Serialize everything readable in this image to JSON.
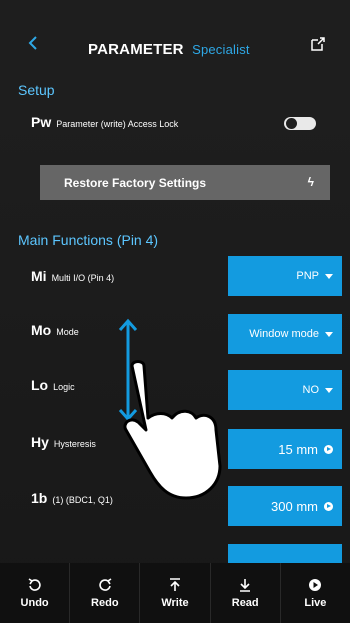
{
  "header": {
    "title": "PARAMETER",
    "subtitle": "Specialist"
  },
  "setup": {
    "section_label": "Setup",
    "lock": {
      "code": "Pw",
      "label": "Parameter (write) Access Lock",
      "enabled": false
    },
    "restore_label": "Restore Factory Settings"
  },
  "main": {
    "section_label": "Main Functions (Pin 4)",
    "rows": [
      {
        "code": "Mi",
        "label": "Multi I/O (Pin 4)",
        "value": "PNP"
      },
      {
        "code": "Mo",
        "label": "Mode",
        "value": "Window mode"
      },
      {
        "code": "Lo",
        "label": "Logic",
        "value": "NO"
      },
      {
        "code": "Hy",
        "label": "Hysteresis",
        "value": "15 mm"
      },
      {
        "code": "1b",
        "label": "(1) (BDC1, Q1)",
        "value": "300 mm"
      }
    ]
  },
  "bottom_bar": {
    "items": [
      {
        "label": "Undo",
        "icon": "undo-icon"
      },
      {
        "label": "Redo",
        "icon": "redo-icon"
      },
      {
        "label": "Write",
        "icon": "write-icon"
      },
      {
        "label": "Read",
        "icon": "read-icon"
      },
      {
        "label": "Live",
        "icon": "live-icon"
      }
    ]
  },
  "colors": {
    "accent": "#139be0",
    "section_text": "#5cc6ff",
    "button_gray": "#666666",
    "background": "#1c1c1c"
  }
}
